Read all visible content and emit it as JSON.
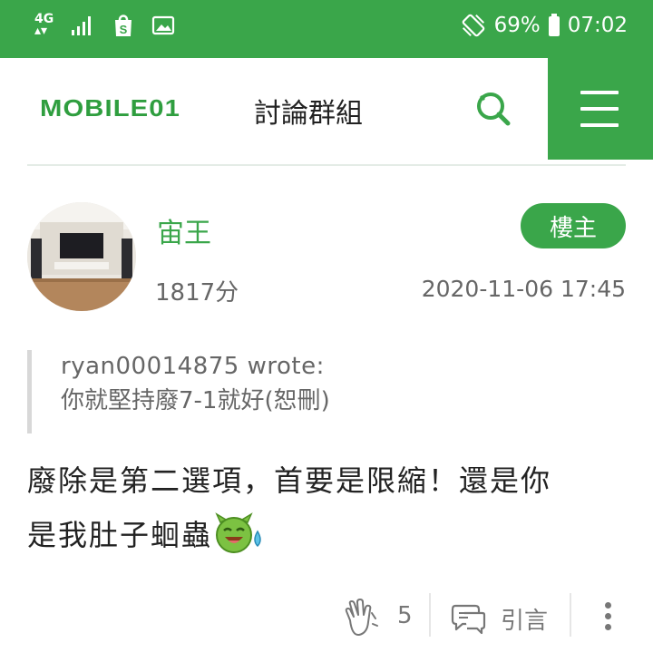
{
  "status_bar": {
    "network_label": "4G",
    "battery_percent": "69%",
    "time": "07:02"
  },
  "header": {
    "logo_text": "MOBILE01",
    "section_title": "討論群組"
  },
  "post": {
    "author": {
      "name": "宙王",
      "score": "1817分"
    },
    "owner_badge": "樓主",
    "timestamp": "2020-11-06 17:45",
    "quote": {
      "author_line": "ryan00014875 wrote:",
      "text": "你就堅持廢7-1就好(恕刪)"
    },
    "content": {
      "line1": "廢除是第二選項，首要是限縮！還是你",
      "line2": "是我肚子蛔蟲"
    },
    "actions": {
      "like_count": "5",
      "quote_label": "引言"
    }
  },
  "colors": {
    "brand_green": "#3aa64a",
    "text_dark": "#222222",
    "text_muted": "#666666"
  },
  "icons": {
    "search": "search-icon",
    "menu": "hamburger-menu-icon",
    "like": "clap-hands-icon",
    "quote": "quote-bubble-icon",
    "more": "more-vertical-icon"
  }
}
